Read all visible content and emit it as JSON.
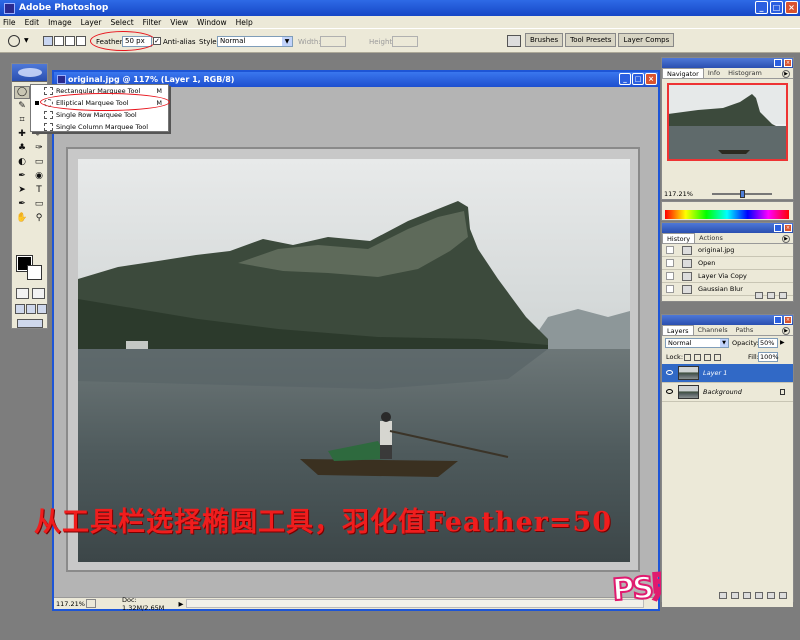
{
  "app": {
    "title": "Adobe Photoshop",
    "minimize": "_",
    "maximize": "□",
    "close": "×"
  },
  "menu": [
    "File",
    "Edit",
    "Image",
    "Layer",
    "Select",
    "Filter",
    "View",
    "Window",
    "Help"
  ],
  "options": {
    "feather_label": "Feather:",
    "feather_value": "50 px",
    "antialias_label": "Anti-alias",
    "antialias_checked": "✓",
    "style_label": "Style:",
    "style_value": "Normal",
    "width_label": "Width:",
    "height_label": "Height:",
    "wells": [
      "Brushes",
      "Tool Presets",
      "Layer Comps"
    ]
  },
  "toolbox": {
    "tools": [
      "◯",
      "✣",
      "✎",
      "⌖",
      "⌗",
      "✂",
      "✚",
      "✐",
      "♣",
      "✑",
      "◐",
      "▭",
      "✒",
      "◉",
      "➤",
      "T",
      "✒",
      "▭",
      "✋",
      "⚲",
      "☝",
      "⊕"
    ]
  },
  "flyout": {
    "items": [
      {
        "label": "Rectangular Marquee Tool",
        "key": "M"
      },
      {
        "label": "Elliptical Marquee Tool",
        "key": "M"
      },
      {
        "label": "Single Row Marquee Tool",
        "key": ""
      },
      {
        "label": "Single Column Marquee Tool",
        "key": ""
      }
    ]
  },
  "document": {
    "title": "original.jpg @ 117% (Layer 1, RGB/8)",
    "zoom": "117.21%",
    "doc_info": "Doc: 1.32M/2.65M",
    "arrow": "▶"
  },
  "caption": "从工具栏选择椭圆工具，羽化值Feather=50",
  "watermark": "PS照片教程",
  "navigator": {
    "tabs": [
      "Navigator",
      "Info",
      "Histogram"
    ],
    "zoom": "117.21%"
  },
  "history": {
    "tabs": [
      "History",
      "Actions"
    ],
    "items": [
      "original.jpg",
      "Open",
      "Layer Via Copy",
      "Gaussian Blur"
    ]
  },
  "layers": {
    "tabs": [
      "Layers",
      "Channels",
      "Paths"
    ],
    "blend_mode": "Normal",
    "opacity_label": "Opacity:",
    "opacity": "50%",
    "lock_label": "Lock:",
    "fill_label": "Fill:",
    "fill": "100%",
    "items": [
      {
        "name": "Layer 1",
        "selected": true
      },
      {
        "name": "Background",
        "selected": false
      }
    ]
  },
  "colors": {
    "accent_title": "#1d4fcf",
    "highlight": "#e8141c",
    "selection": "#3169c6"
  },
  "icons": [
    "photoshop-icon",
    "marquee-icon",
    "eye-icon",
    "lock-icon",
    "palette-menu-icon"
  ]
}
